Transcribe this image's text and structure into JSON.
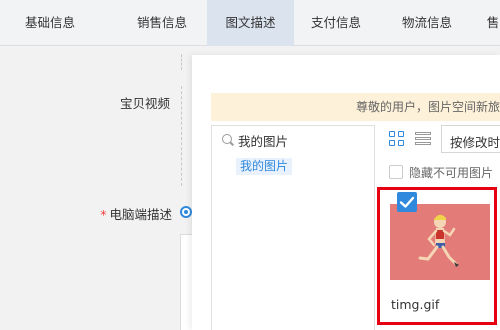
{
  "tabs": [
    {
      "label": "基础信息"
    },
    {
      "label": "销售信息"
    },
    {
      "label": "图文描述"
    },
    {
      "label": "支付信息"
    },
    {
      "label": "物流信息"
    },
    {
      "label": "售"
    }
  ],
  "form": {
    "video_label": "宝贝视频",
    "required_mark": "*",
    "pc_desc_label": "电脑端描述"
  },
  "dialog": {
    "notice": "尊敬的用户，图片空间新旅",
    "search_text": "我的图片",
    "folder_label": "我的图片",
    "sort_label": "按修改时",
    "hide_unavailable_label": "隐藏不可用图片",
    "image": {
      "filename": "timg.gif",
      "thumbnail_bg": "#e37b79",
      "checked": true
    }
  },
  "colors": {
    "accent": "#3089dc",
    "highlight_border": "#e60012",
    "notice_bg": "#fdf1d9",
    "active_tab_bg": "#dbe3ef"
  }
}
